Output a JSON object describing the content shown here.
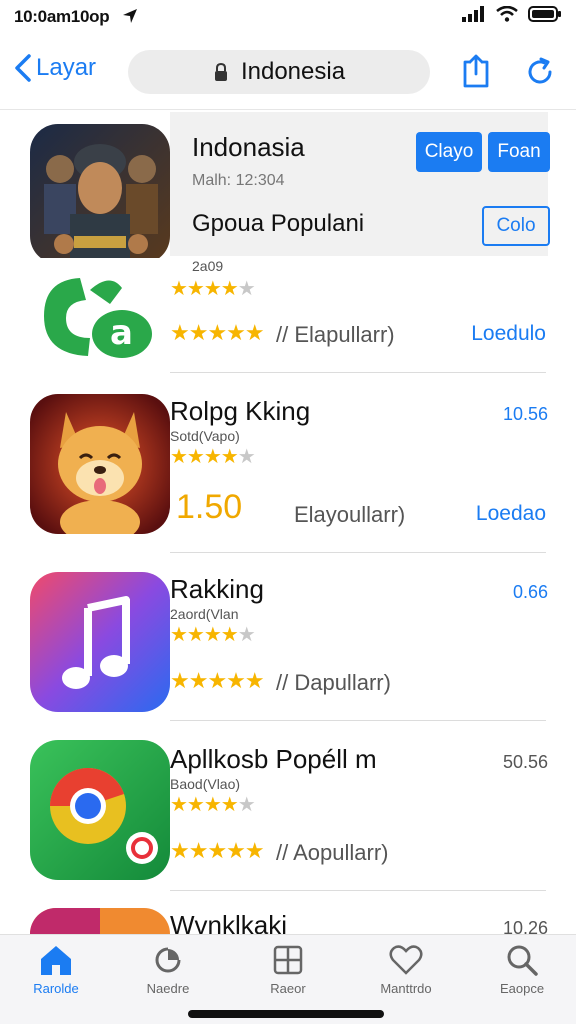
{
  "status_bar": {
    "time": "10:0am10op"
  },
  "nav": {
    "back_label": "Layar",
    "address": "Indonesia"
  },
  "featured": {
    "title": "Indonasia",
    "subtitle": "Malh: 12:304",
    "section_label": "Gpoua Populani",
    "button_primary": "Clayo",
    "button_secondary": "Foan",
    "button_outline": "Colo",
    "next_caption": "2a09"
  },
  "apps": [
    {
      "title": "",
      "subtitle": "2a09",
      "rating_text": "// Elapullarr)",
      "action": "Loedulo",
      "meta": ""
    },
    {
      "title": "Rolpg Kking",
      "subtitle": "Sotd(Vapo)",
      "score": "1.50",
      "rating_text": "Elayoullarr)",
      "action": "Loedao",
      "meta": "10.56"
    },
    {
      "title": "Rakking",
      "subtitle": "2aord(Vlan",
      "rating_text": "// Dapullarr)",
      "action": "",
      "meta": "0.66"
    },
    {
      "title": "Apllkosb Popéll m",
      "subtitle": "Baod(Vlao)",
      "rating_text": "// Aopullarr)",
      "action": "",
      "meta": "50.56"
    },
    {
      "title": "Wvnklkaki",
      "subtitle": "",
      "rating_text": "",
      "action": "",
      "meta": "10.26"
    }
  ],
  "tabs": [
    {
      "label": "Rarolde",
      "icon": "home-icon",
      "active": true
    },
    {
      "label": "Naedre",
      "icon": "pie-chart-icon",
      "active": false
    },
    {
      "label": "Raeor",
      "icon": "grid-icon",
      "active": false
    },
    {
      "label": "Manttrdo",
      "icon": "heart-icon",
      "active": false
    },
    {
      "label": "Eaopce",
      "icon": "search-icon",
      "active": false
    }
  ],
  "colors": {
    "accent": "#1b7cf2",
    "star": "#f7b500",
    "featured_bg": "#f1f1f1"
  }
}
